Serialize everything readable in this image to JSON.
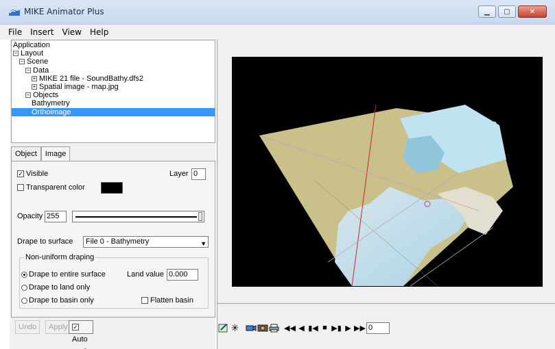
{
  "window": {
    "title": "MIKE Animator Plus"
  },
  "menu": [
    "File",
    "Insert",
    "View",
    "Help"
  ],
  "tree": [
    {
      "label": "Application",
      "indent": 0,
      "expander": ""
    },
    {
      "label": "Layout",
      "indent": 0,
      "expander": "−"
    },
    {
      "label": "Scene",
      "indent": 1,
      "expander": "−"
    },
    {
      "label": "Data",
      "indent": 2,
      "expander": "−"
    },
    {
      "label": "MIKE 21 file - SoundBathy.dfs2",
      "indent": 3,
      "expander": "+"
    },
    {
      "label": "Spatial image - map.jpg",
      "indent": 3,
      "expander": "+"
    },
    {
      "label": "Objects",
      "indent": 2,
      "expander": "−"
    },
    {
      "label": "Bathymetry",
      "indent": 3,
      "expander": ""
    },
    {
      "label": "Orthoimage",
      "indent": 3,
      "expander": "",
      "selected": true
    }
  ],
  "tabs": {
    "object": "Object",
    "image": "Image"
  },
  "props": {
    "visible_label": "Visible",
    "layer_label": "Layer",
    "layer_value": "0",
    "transparent_label": "Transparent color",
    "opacity_label": "Opacity",
    "opacity_value": "255",
    "drape_label": "Drape to surface",
    "drape_value": "File 0 - Bathymetry",
    "group_title": "Non-uniform draping",
    "entire_label": "Drape to entire surface",
    "land_value_label": "Land value",
    "land_value": "0.000",
    "land_only_label": "Drape to land only",
    "basin_only_label": "Drape to basin only",
    "flatten_label": "Flatten basin"
  },
  "buttons": {
    "undo": "Undo",
    "apply": "Apply",
    "auto_apply": "Auto apply"
  },
  "playback": {
    "frame": "0"
  },
  "colors": {
    "selection": "#3399ff",
    "viewport_bg": "#000000"
  },
  "icons": [
    "edit-icon",
    "asterisk-icon",
    "camera-icon",
    "photo-icon",
    "print-icon",
    "rewind-icon",
    "step-back-icon",
    "to-start-icon",
    "stop-icon",
    "to-end-icon",
    "step-forward-icon",
    "fast-forward-icon"
  ]
}
